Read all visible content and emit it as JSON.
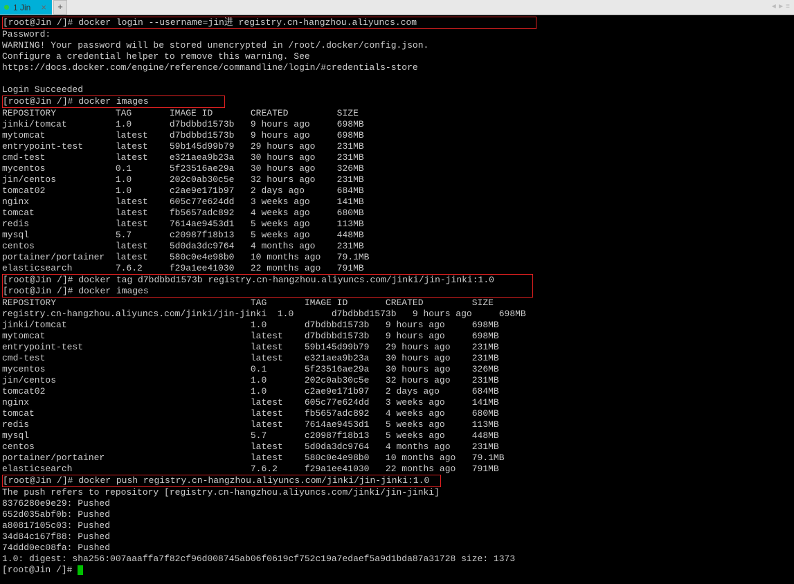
{
  "tab": {
    "label": "1 Jin",
    "add": "+"
  },
  "nav": {
    "left": "◄",
    "right": "►",
    "menu": "≡"
  },
  "prompt": "[root@Jin /]#",
  "cmds": {
    "login": "docker login --username=jin进 registry.cn-hangzhou.aliyuncs.com",
    "password": "Password:",
    "warn1": "WARNING! Your password will be stored unencrypted in /root/.docker/config.json.",
    "warn2": "Configure a credential helper to remove this warning. See",
    "warn3": "https://docs.docker.com/engine/reference/commandline/login/#credentials-store",
    "loginok": "Login Succeeded",
    "images": "docker images",
    "tag": "docker tag d7bdbbd1573b registry.cn-hangzhou.aliyuncs.com/jinki/jin-jinki:1.0",
    "push": "docker push registry.cn-hangzhou.aliyuncs.com/jinki/jin-jinki:1.0",
    "pushmsg": "The push refers to repository [registry.cn-hangzhou.aliyuncs.com/jinki/jin-jinki]"
  },
  "header1": "REPOSITORY           TAG       IMAGE ID       CREATED         SIZE",
  "rows1": [
    "jinki/tomcat         1.0       d7bdbbd1573b   9 hours ago     698MB",
    "mytomcat             latest    d7bdbbd1573b   9 hours ago     698MB",
    "entrypoint-test      latest    59b145d99b79   29 hours ago    231MB",
    "cmd-test             latest    e321aea9b23a   30 hours ago    231MB",
    "mycentos             0.1       5f23516ae29a   30 hours ago    326MB",
    "jin/centos           1.0       202c0ab30c5e   32 hours ago    231MB",
    "tomcat02             1.0       c2ae9e171b97   2 days ago      684MB",
    "nginx                latest    605c77e624dd   3 weeks ago     141MB",
    "tomcat               latest    fb5657adc892   4 weeks ago     680MB",
    "redis                latest    7614ae9453d1   5 weeks ago     113MB",
    "mysql                5.7       c20987f18b13   5 weeks ago     448MB",
    "centos               latest    5d0da3dc9764   4 months ago    231MB",
    "portainer/portainer  latest    580c0e4e98b0   10 months ago   79.1MB",
    "elasticsearch        7.6.2     f29a1ee41030   22 months ago   791MB"
  ],
  "header2": "REPOSITORY                                    TAG       IMAGE ID       CREATED         SIZE",
  "rows2": [
    "registry.cn-hangzhou.aliyuncs.com/jinki/jin-jinki  1.0       d7bdbbd1573b   9 hours ago     698MB",
    "jinki/tomcat                                  1.0       d7bdbbd1573b   9 hours ago     698MB",
    "mytomcat                                      latest    d7bdbbd1573b   9 hours ago     698MB",
    "entrypoint-test                               latest    59b145d99b79   29 hours ago    231MB",
    "cmd-test                                      latest    e321aea9b23a   30 hours ago    231MB",
    "mycentos                                      0.1       5f23516ae29a   30 hours ago    326MB",
    "jin/centos                                    1.0       202c0ab30c5e   32 hours ago    231MB",
    "tomcat02                                      1.0       c2ae9e171b97   2 days ago      684MB",
    "nginx                                         latest    605c77e624dd   3 weeks ago     141MB",
    "tomcat                                        latest    fb5657adc892   4 weeks ago     680MB",
    "redis                                         latest    7614ae9453d1   5 weeks ago     113MB",
    "mysql                                         5.7       c20987f18b13   5 weeks ago     448MB",
    "centos                                        latest    5d0da3dc9764   4 months ago    231MB",
    "portainer/portainer                           latest    580c0e4e98b0   10 months ago   79.1MB",
    "elasticsearch                                 7.6.2     f29a1ee41030   22 months ago   791MB"
  ],
  "pushlines": [
    "8376280e9e29: Pushed",
    "652d035abf0b: Pushed",
    "a80817105c03: Pushed",
    "34d84c167f88: Pushed",
    "74ddd0ec08fa: Pushed",
    "1.0: digest: sha256:007aaaffa7f82cf96d008745ab06f0619cf752c19a7edaef5a9d1bda87a31728 size: 1373"
  ]
}
